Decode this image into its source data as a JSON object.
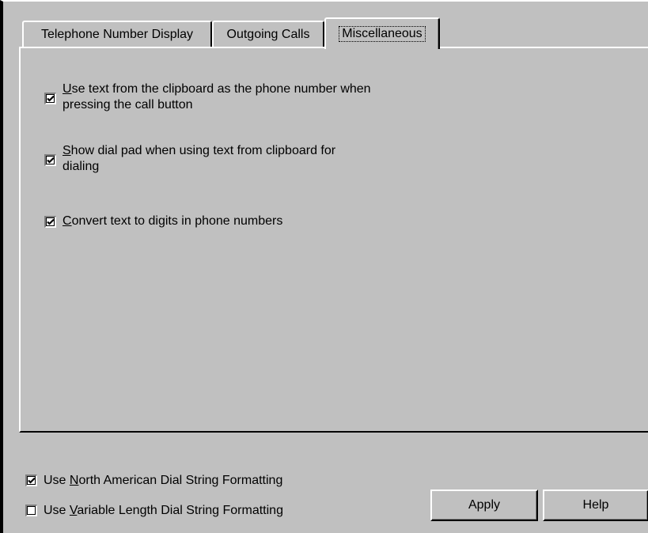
{
  "tabs": {
    "phone_label": "Telephone Number Display",
    "outgoing_label": "Outgoing Calls",
    "misc_label": "Miscellaneous",
    "active": "Miscellaneous"
  },
  "misc_options": {
    "clipboard": {
      "mnemonic": "U",
      "rest": "se text from the clipboard as the phone number when",
      "line2": "pressing the call button",
      "checked": true
    },
    "dialpad": {
      "mnemonic": "S",
      "rest": "how dial pad when using text from clipboard for",
      "line2": "dialing",
      "checked": true
    },
    "convert": {
      "mnemonic": "C",
      "rest": "onvert text to digits in phone numbers",
      "checked": true
    }
  },
  "global_options": {
    "north_american": {
      "prefix": "Use ",
      "mnemonic": "N",
      "rest": "orth American Dial String Formatting",
      "checked": true
    },
    "variable_length": {
      "prefix": "Use ",
      "mnemonic": "V",
      "rest": "ariable Length Dial String Formatting",
      "checked": false
    }
  },
  "buttons": {
    "apply_label": "Apply",
    "help_label": "Help"
  },
  "colors": {
    "face": "#c0c0c0",
    "highlight": "#ffffff",
    "shadow": "#808080",
    "dark_shadow": "#000000"
  }
}
